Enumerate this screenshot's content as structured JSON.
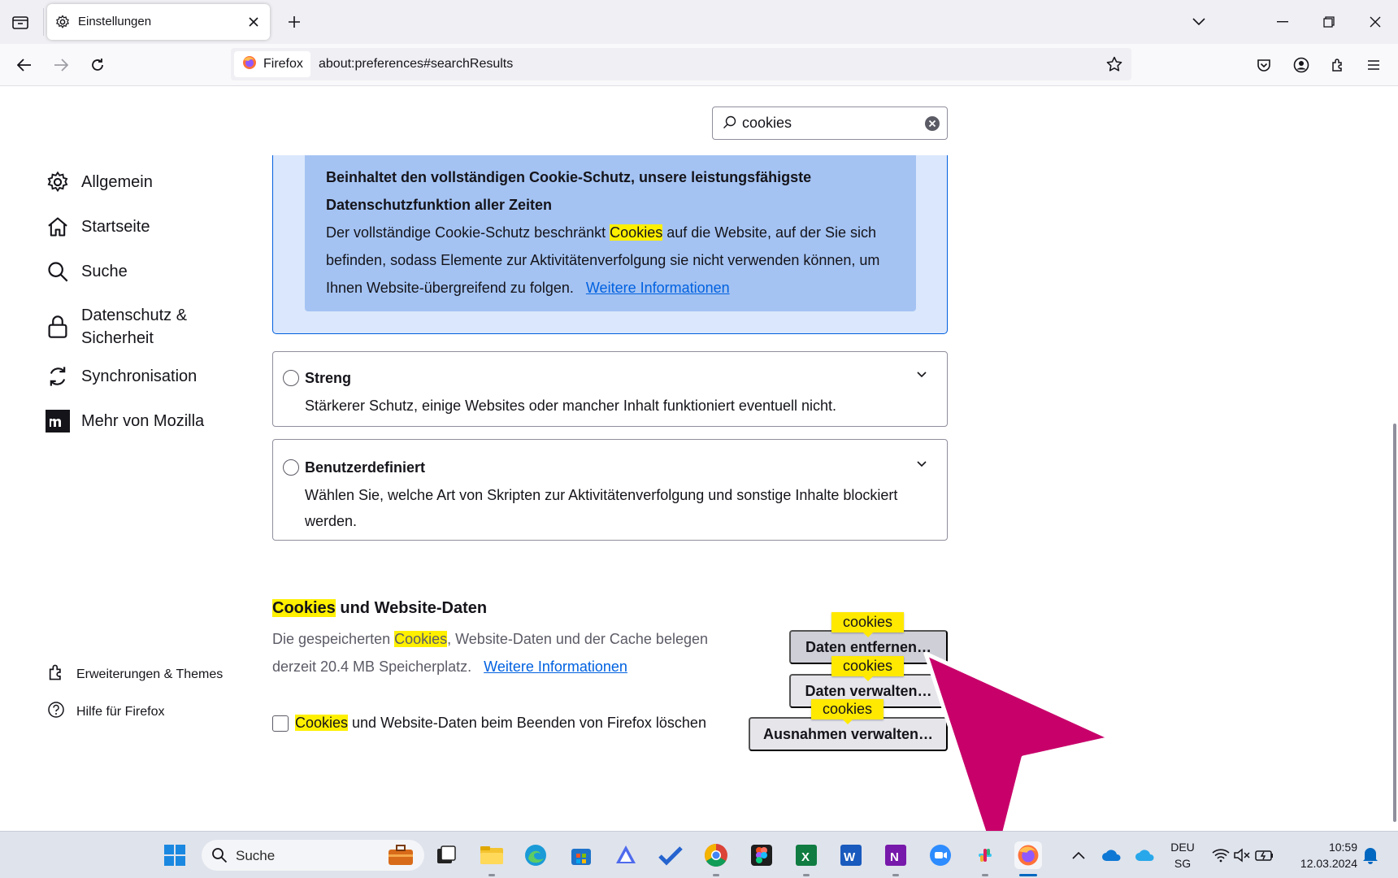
{
  "browser": {
    "tab": {
      "title": "Einstellungen"
    },
    "identity_label": "Firefox",
    "url": "about:preferences#searchResults"
  },
  "search": {
    "value": "cookies"
  },
  "sidebar": {
    "items": [
      {
        "label": "Allgemein",
        "icon": "gear-icon"
      },
      {
        "label": "Startseite",
        "icon": "home-icon"
      },
      {
        "label": "Suche",
        "icon": "search-icon"
      },
      {
        "label": "Datenschutz & Sicherheit",
        "icon": "lock-icon"
      },
      {
        "label": "Synchronisation",
        "icon": "sync-icon"
      },
      {
        "label": "Mehr von Mozilla",
        "icon": "mozilla-icon"
      }
    ],
    "footer": [
      {
        "label": "Erweiterungen & Themes",
        "icon": "puzzle-icon"
      },
      {
        "label": "Hilfe für Firefox",
        "icon": "help-icon"
      }
    ]
  },
  "standard_card": {
    "heading": "Beinhaltet den vollständigen Cookie-Schutz, unsere leistungsfähigste Datenschutzfunktion aller Zeiten",
    "text_before": "Der vollständige Cookie-Schutz beschränkt ",
    "highlight": "Cookies",
    "text_after": " auf die Website, auf der Sie sich befinden, sodass Elemente zur Aktivitätenverfolgung sie nicht verwenden können, um Ihnen Website-übergreifend zu folgen.",
    "link": "Weitere Informationen"
  },
  "options": {
    "strict": {
      "title": "Streng",
      "desc": "Stärkerer Schutz, einige Websites oder mancher Inhalt funktioniert eventuell nicht."
    },
    "custom": {
      "title": "Benutzerdefiniert",
      "desc": "Wählen Sie, welche Art von Skripten zur Aktivitätenverfolgung und sonstige Inhalte blockiert werden."
    }
  },
  "cookies_section": {
    "title_highlight": "Cookies",
    "title_rest": " und Website-Daten",
    "desc_before": "Die gespeicherten ",
    "desc_highlight": "Cookies",
    "desc_after": ", Website-Daten und der Cache belegen derzeit 20.4 MB Speicherplatz.",
    "link": "Weitere Informationen",
    "checkbox_highlight": "Cookies",
    "checkbox_rest": " und Website-Daten beim Beenden von Firefox löschen",
    "buttons": {
      "clear": "Daten entfernen…",
      "manage": "Daten verwalten…",
      "exceptions": "Ausnahmen verwalten…"
    },
    "tag_label": "cookies"
  },
  "taskbar": {
    "search_label": "Suche",
    "lang_top": "DEU",
    "lang_bottom": "SG",
    "time": "10:59",
    "date": "12.03.2024"
  },
  "colors": {
    "accent": "#0061e0",
    "highlight": "#fff000",
    "card_bg": "#dbe7fc",
    "card_inner": "#a4c3f3",
    "cursor": "#c8006a"
  }
}
